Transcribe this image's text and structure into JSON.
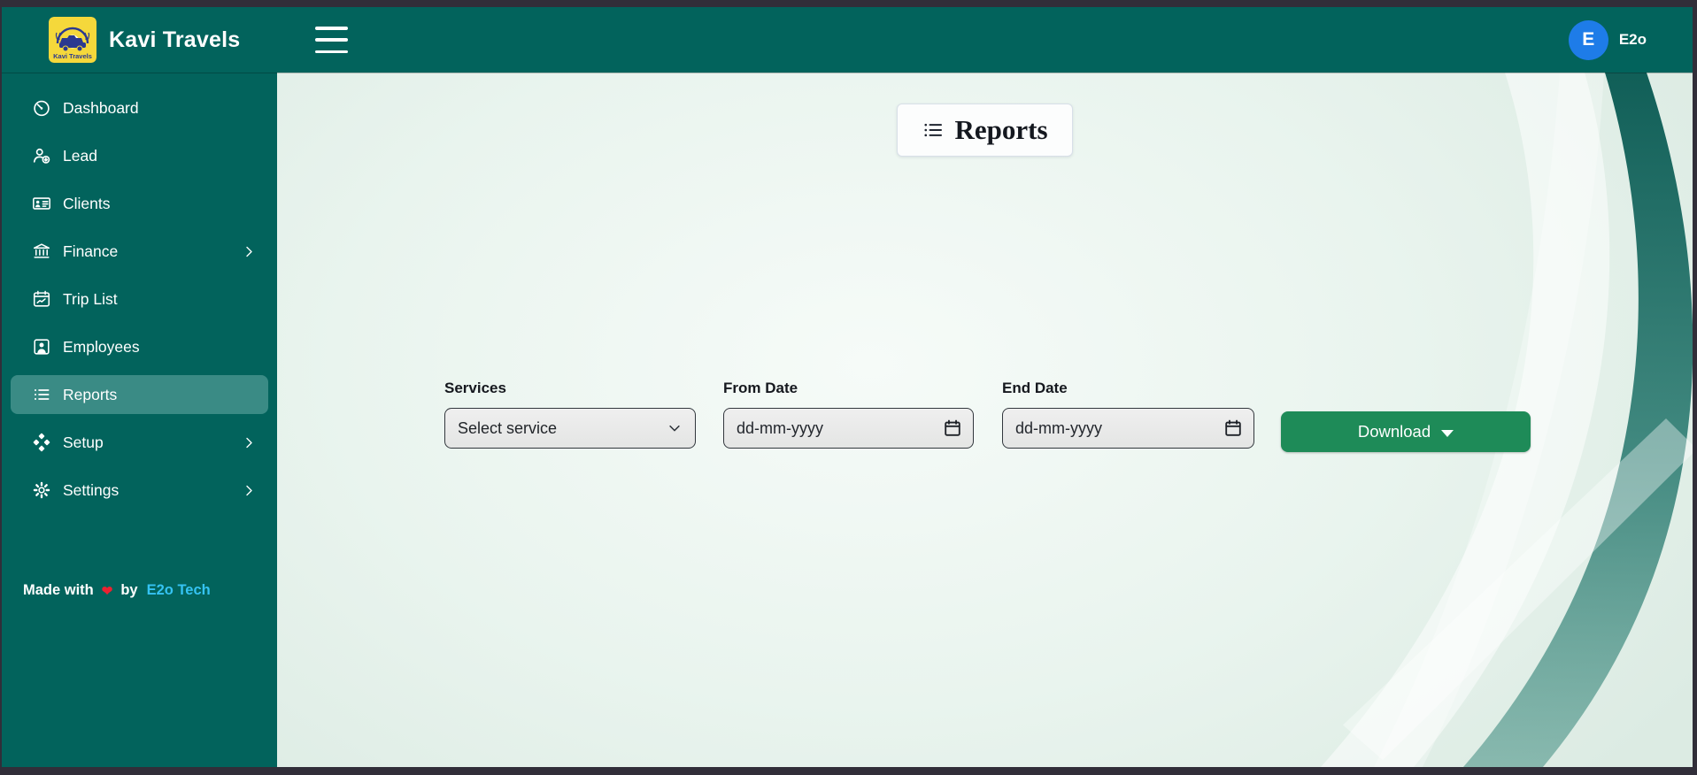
{
  "topbar": {
    "brand": "Kavi Travels",
    "logo_text": "Kavi Travels",
    "user_initial": "E",
    "user_name": "E2o"
  },
  "sidebar": {
    "items": [
      {
        "label": "Dashboard"
      },
      {
        "label": "Lead"
      },
      {
        "label": "Clients"
      },
      {
        "label": "Finance"
      },
      {
        "label": "Trip List"
      },
      {
        "label": "Employees"
      },
      {
        "label": "Reports"
      },
      {
        "label": "Setup"
      },
      {
        "label": "Settings"
      }
    ],
    "footer": {
      "made_with": "Made with",
      "heart": "❤",
      "by": "by",
      "brand_link": "E2o Tech"
    }
  },
  "main": {
    "page_title": "Reports",
    "form": {
      "services_label": "Services",
      "services_value": "Select service",
      "from_date_label": "From Date",
      "from_date_placeholder": "dd-mm-yyyy",
      "end_date_label": "End Date",
      "end_date_placeholder": "dd-mm-yyyy",
      "download_label": "Download"
    }
  },
  "colors": {
    "brand_teal": "#02635c",
    "active_item_teal": "#3a8b85",
    "download_green": "#1e8b58",
    "avatar_blue": "#1e7ce8",
    "credit_link_cyan": "#35c3f3",
    "heart_red": "#ec2231",
    "window_frame": "#312e39"
  }
}
